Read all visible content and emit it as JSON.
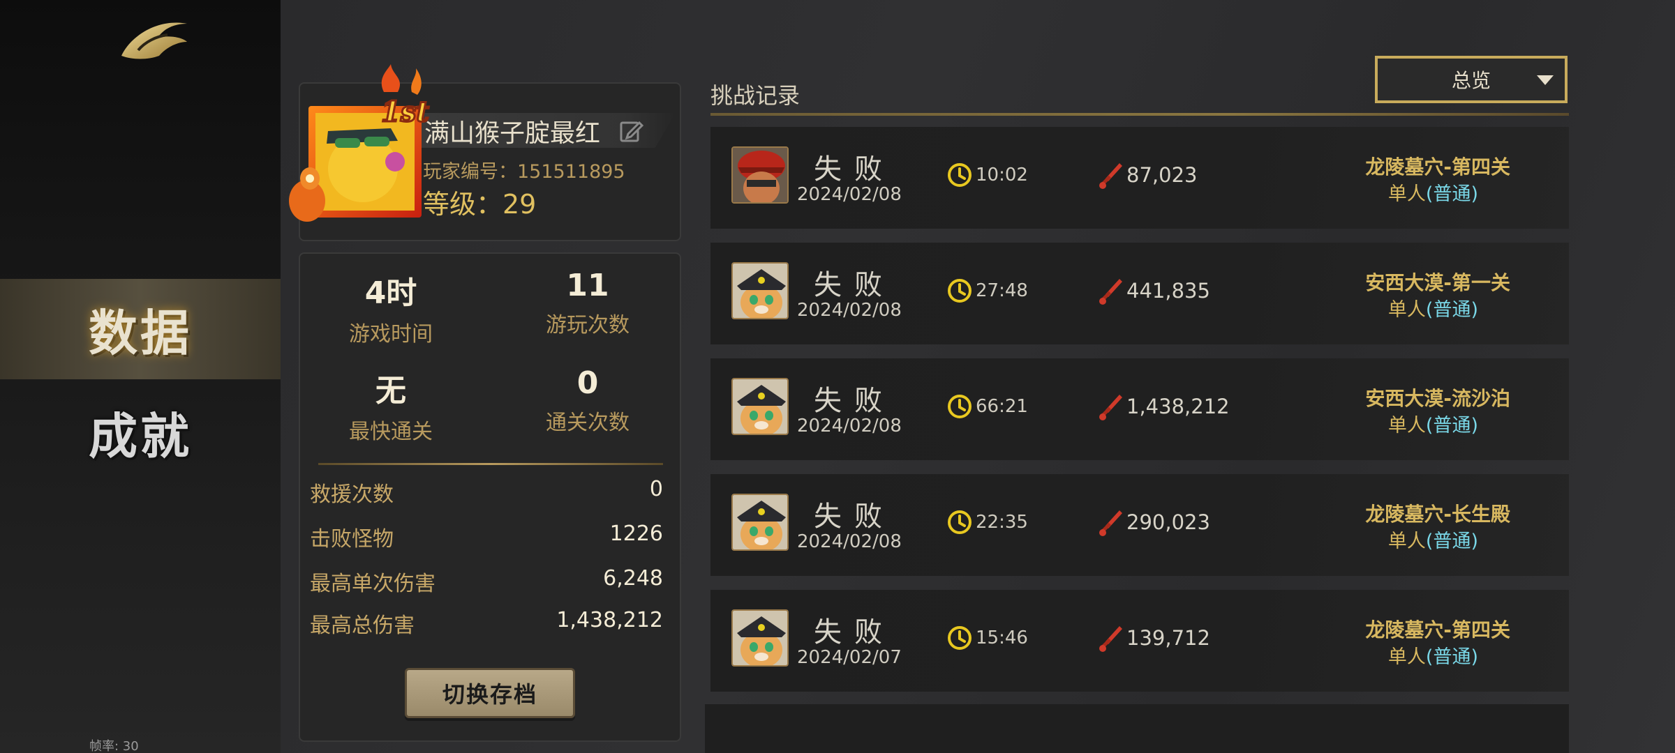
{
  "nav": {
    "items": [
      {
        "label": "数据",
        "active": true
      },
      {
        "label": "成就",
        "active": false
      }
    ],
    "fps": "帧率: 30"
  },
  "profile": {
    "name": "满山猴子腚最红",
    "id_label": "玩家编号：151511895",
    "level_label": "等级：29",
    "rank_badge": "1st"
  },
  "stats": {
    "play_time": {
      "value": "4时",
      "label": "游戏时间"
    },
    "play_count": {
      "value": "11",
      "label": "游玩次数"
    },
    "fastest_clear": {
      "value": "无",
      "label": "最快通关"
    },
    "clear_count": {
      "value": "0",
      "label": "通关次数"
    },
    "rows": [
      {
        "label": "救援次数",
        "value": "0"
      },
      {
        "label": "击败怪物",
        "value": "1226"
      },
      {
        "label": "最高单次伤害",
        "value": "6,248"
      },
      {
        "label": "最高总伤害",
        "value": "1,438,212"
      }
    ],
    "switch_button": "切换存档"
  },
  "records": {
    "title": "挑战记录",
    "filter": "总览",
    "items": [
      {
        "result": "失败",
        "date": "2024/02/08",
        "time": "10:02",
        "damage": "87,023",
        "stage": "龙陵墓穴-第四关",
        "mode": "单人",
        "difficulty": "(普通)",
        "portrait": "red-hat-hero"
      },
      {
        "result": "失败",
        "date": "2024/02/08",
        "time": "27:48",
        "damage": "441,835",
        "stage": "安西大漠-第一关",
        "mode": "单人",
        "difficulty": "(普通)",
        "portrait": "cat-hero"
      },
      {
        "result": "失败",
        "date": "2024/02/08",
        "time": "66:21",
        "damage": "1,438,212",
        "stage": "安西大漠-流沙泊",
        "mode": "单人",
        "difficulty": "(普通)",
        "portrait": "cat-hero"
      },
      {
        "result": "失败",
        "date": "2024/02/08",
        "time": "22:35",
        "damage": "290,023",
        "stage": "龙陵墓穴-长生殿",
        "mode": "单人",
        "difficulty": "(普通)",
        "portrait": "cat-hero"
      },
      {
        "result": "失败",
        "date": "2024/02/07",
        "time": "15:46",
        "damage": "139,712",
        "stage": "龙陵墓穴-第四关",
        "mode": "单人",
        "difficulty": "(普通)",
        "portrait": "cat-hero"
      }
    ]
  },
  "colors": {
    "accent_gold": "#c8ab5c",
    "difficulty_cyan": "#7ad8e8",
    "stage_gold": "#d8b860",
    "clock_yellow": "#e8c820",
    "sword_red": "#d03a2a"
  }
}
